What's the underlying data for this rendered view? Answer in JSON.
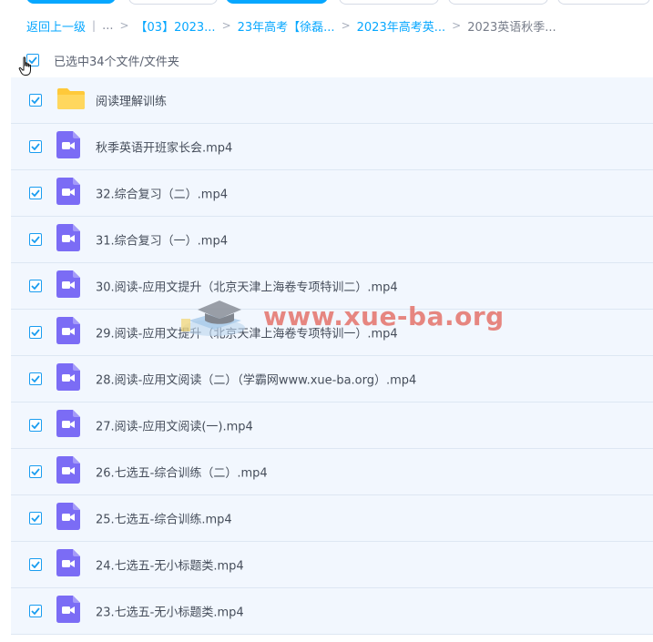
{
  "breadcrumb": {
    "back": "返回上一级",
    "ellipsis": "...",
    "items": [
      "【03】2023...",
      "23年高考【徐磊...",
      "2023年高考英...",
      "2023英语秋季..."
    ]
  },
  "selection": {
    "label": "已选中34个文件/文件夹"
  },
  "files": [
    {
      "name": "阅读理解训练",
      "type": "folder-icon"
    },
    {
      "name": "秋季英语开班家长会.mp4",
      "type": "video-icon"
    },
    {
      "name": "32.综合复习（二）.mp4",
      "type": "video-icon"
    },
    {
      "name": "31.综合复习（一）.mp4",
      "type": "video-icon"
    },
    {
      "name": "30.阅读-应用文提升（北京天津上海卷专项特训二）.mp4",
      "type": "video-icon"
    },
    {
      "name": "29.阅读-应用文提升（北京天津上海卷专项特训一）.mp4",
      "type": "video-icon"
    },
    {
      "name": "28.阅读-应用文阅读（二）（学霸网www.xue-ba.org）.mp4",
      "type": "video-icon"
    },
    {
      "name": "27.阅读-应用文阅读(一).mp4",
      "type": "video-icon"
    },
    {
      "name": "26.七选五-综合训练（二）.mp4",
      "type": "video-icon"
    },
    {
      "name": "25.七选五-综合训练.mp4",
      "type": "video-icon"
    },
    {
      "name": "24.七选五-无小标题类.mp4",
      "type": "video-icon"
    },
    {
      "name": "23.七选五-无小标题类.mp4",
      "type": "video-icon"
    }
  ],
  "watermark": {
    "text": "www.xue-ba.org"
  },
  "colors": {
    "accent": "#06a7ff",
    "video": "#7b6cf5",
    "folder": "#ffd049",
    "row_bg": "#f2f7fe"
  }
}
